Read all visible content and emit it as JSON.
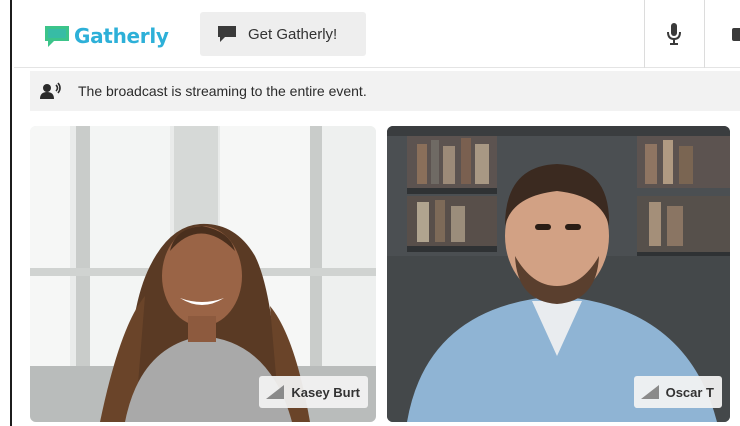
{
  "header": {
    "logo_text": "Gatherly",
    "get_button_label": "Get Gatherly!"
  },
  "banner": {
    "icon": "broadcast-speaker-icon",
    "text": "The broadcast is streaming to the entire event."
  },
  "participants": [
    {
      "name": "Kasey Burt",
      "icon": "signal-strength-icon"
    },
    {
      "name": "Oscar T",
      "icon": "signal-strength-icon"
    }
  ],
  "colors": {
    "brand": "#2db0d8",
    "logo_icon_green": "#3cc48a",
    "button_bg": "#eeeeee",
    "banner_bg": "#f2f2f2"
  }
}
